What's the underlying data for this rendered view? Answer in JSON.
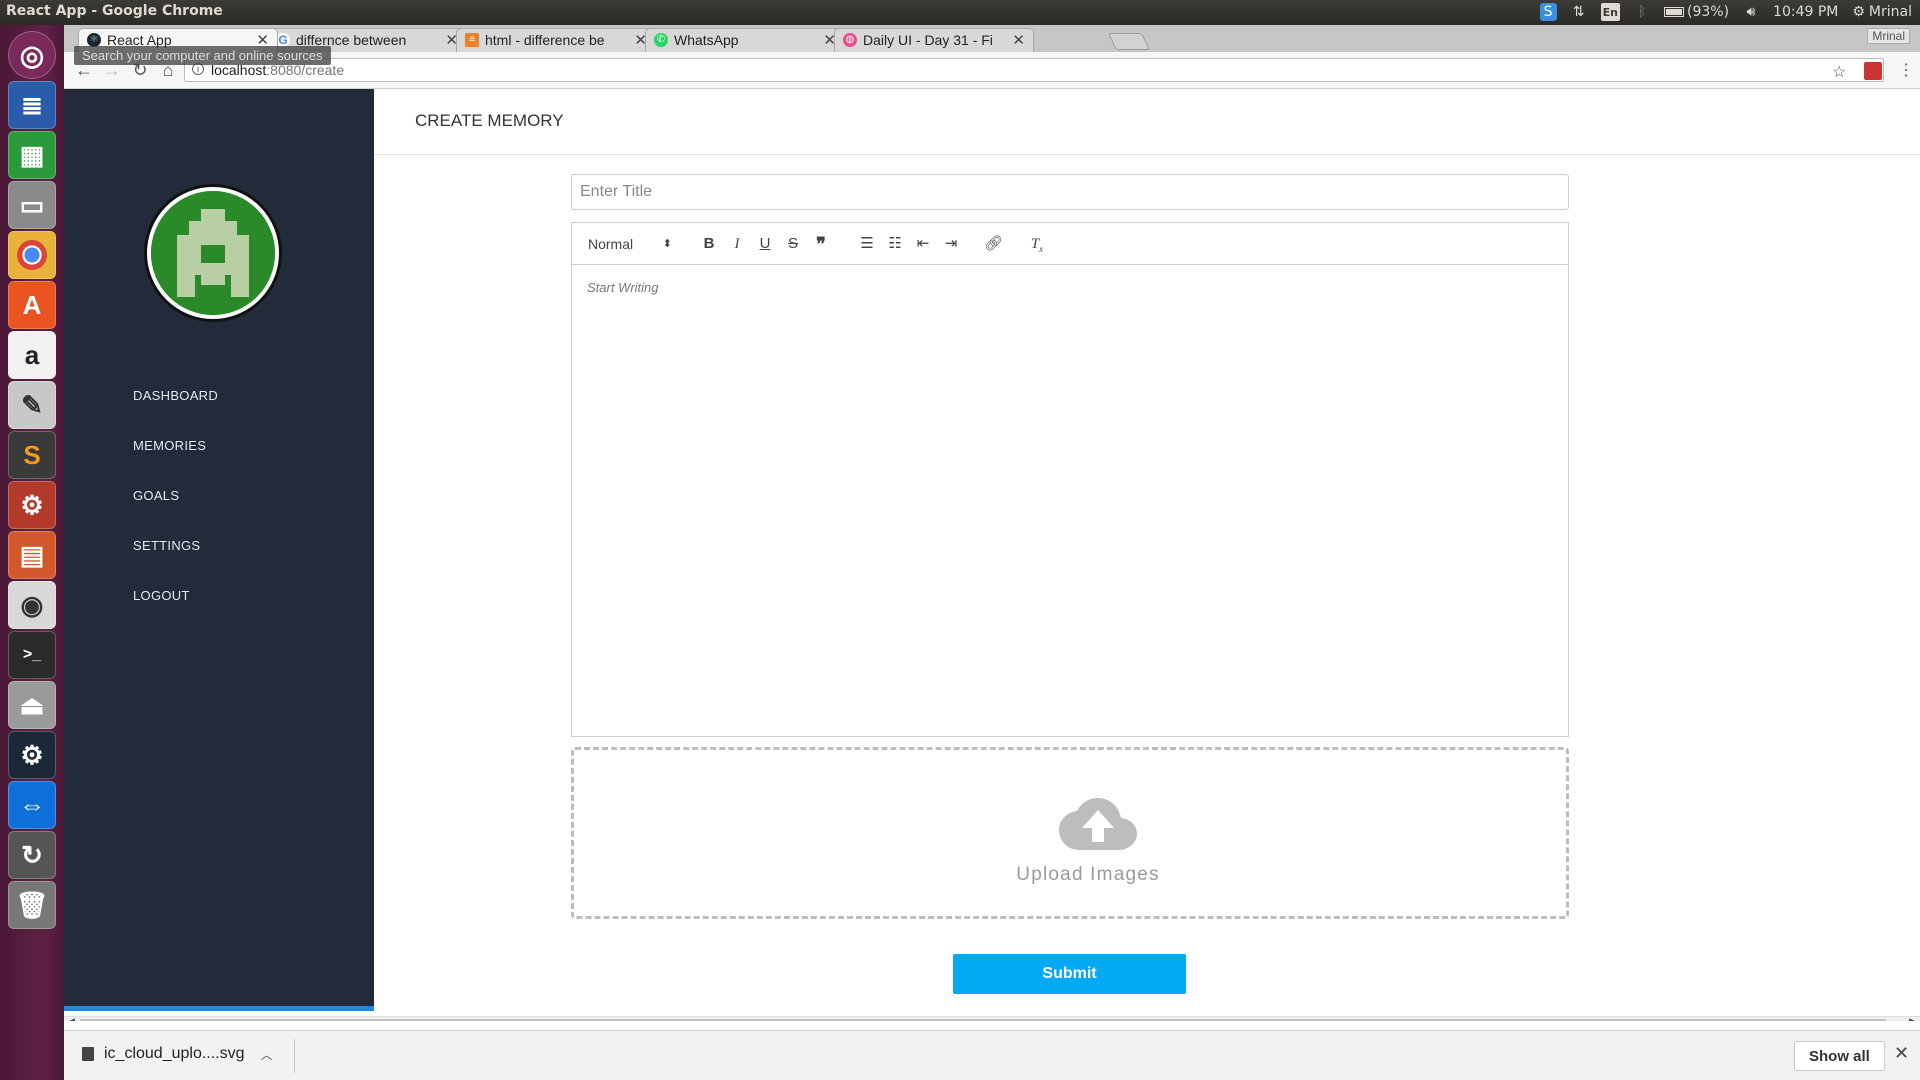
{
  "os": {
    "window_title": "React App - Google Chrome",
    "tray": {
      "language": "En",
      "battery": "(93%)",
      "time": "10:49 PM",
      "user": "Mrinal"
    }
  },
  "browser": {
    "tabs": [
      {
        "label": "React App",
        "active": true
      },
      {
        "label": "differnce between"
      },
      {
        "label": "html - difference be"
      },
      {
        "label": "WhatsApp"
      },
      {
        "label": "Daily UI - Day 31 - Fi"
      }
    ],
    "profile": "Mrinal",
    "search_tooltip": "Search your computer and online sources",
    "url_host": "localhost",
    "url_path": ":8080/create"
  },
  "sidebar": {
    "items": [
      {
        "label": "DASHBOARD"
      },
      {
        "label": "MEMORIES"
      },
      {
        "label": "GOALS"
      },
      {
        "label": "SETTINGS"
      },
      {
        "label": "LOGOUT"
      }
    ]
  },
  "page": {
    "title": "CREATE MEMORY",
    "title_placeholder": "Enter Title",
    "editor": {
      "format": "Normal",
      "placeholder": "Start Writing"
    },
    "upload_label": "Upload Images",
    "submit_label": "Submit"
  },
  "downloads": {
    "file_name": "ic_cloud_uplo....svg",
    "show_all_label": "Show all"
  },
  "colors": {
    "sidebar_bg": "#232a3a",
    "accent": "#03a9f4",
    "avatar_bg": "#2a8a2a"
  }
}
